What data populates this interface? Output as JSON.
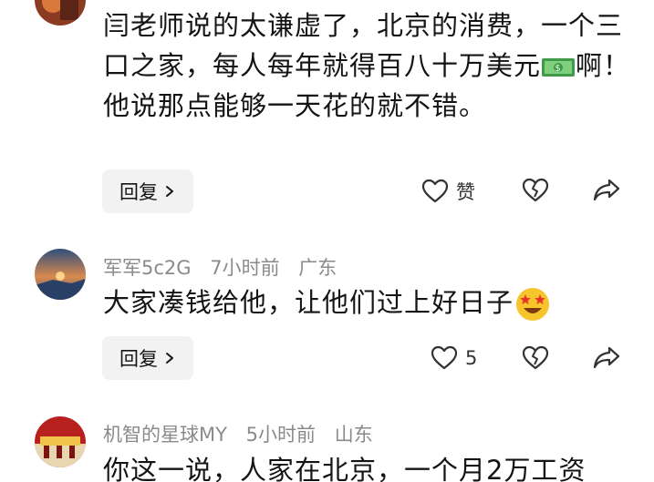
{
  "comments": [
    {
      "text_parts": [
        "闫老师说的太谦虚了，北京的消费，一个三口之家，每人每年就得百八十万美元",
        "啊！他说那点能够一天花的就不错。"
      ],
      "inline_emoji": "dollar-banknote-emoji",
      "reply_label": "回复",
      "like_label": "赞"
    },
    {
      "username": "军军5c2G",
      "time": "7小时前",
      "region": "广东",
      "text": "大家凑钱给他，让他们过上好日子",
      "inline_emoji": "star-struck-emoji",
      "reply_label": "回复",
      "like_count": "5"
    },
    {
      "username": "机智的星球MY",
      "time": "5小时前",
      "region": "山东",
      "text": "你这一说，人家在北京，一个月2万工资"
    }
  ],
  "icons": {
    "like": "heart-outline-icon",
    "dislike": "broken-heart-icon",
    "share": "share-arrow-icon",
    "reply_arrow": "chevron-right-icon"
  },
  "colors": {
    "meta_text": "#8a8a8a",
    "button_bg": "#f2f2f2",
    "text": "#141414"
  }
}
